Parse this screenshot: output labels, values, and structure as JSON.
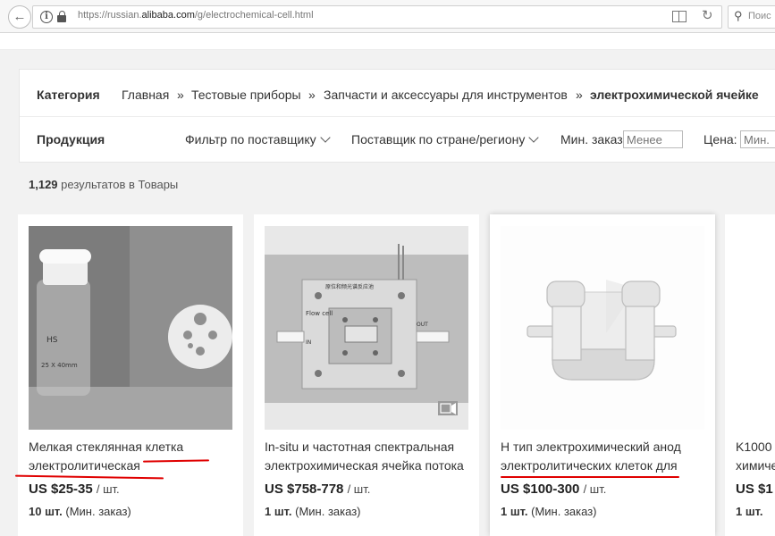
{
  "browser": {
    "url_prefix": "https://russian.",
    "url_domain": "alibaba.com",
    "url_path": "/g/electrochemical-cell.html",
    "search_placeholder": "Поис"
  },
  "breadcrumb": {
    "label": "Категория",
    "items": [
      "Главная",
      "Тестовые приборы",
      "Запчасти и аксессуары для инструментов",
      "электрохимической ячейке"
    ],
    "separator": "»"
  },
  "filters": {
    "label": "Продукция",
    "supplier_filter": "Фильтр по поставщику",
    "country_filter": "Поставщик по стране/региону",
    "min_order_label": "Мин. заказ",
    "min_order_placeholder": "Менее",
    "price_label": "Цена:",
    "price_placeholder": "Мин."
  },
  "results": {
    "count": "1,129",
    "text": "результатов в Товары"
  },
  "products": [
    {
      "title_line1": "Мелкая стеклянная клетка",
      "title_line2": "электролитическая",
      "price": "US $25-35",
      "unit": "/ шт.",
      "moq_qty": "10 шт.",
      "moq_label": "(Мин. заказ)"
    },
    {
      "title_line1": "In-situ и частотная спектральная",
      "title_line2": "электрохимическая ячейка потока",
      "price": "US $758-778",
      "unit": "/ шт.",
      "moq_qty": "1 шт.",
      "moq_label": "(Мин. заказ)",
      "image_text_top": "原位和频光谱反应池",
      "image_text_flow": "Flow cell",
      "image_text_in": "IN",
      "image_text_out": "OUT"
    },
    {
      "title_line1": "Н тип электрохимический анод",
      "title_line2": "электролитических клеток для",
      "price": "US $100-300",
      "unit": "/ шт.",
      "moq_qty": "1 шт.",
      "moq_label": "(Мин. заказ)"
    },
    {
      "title_line1": "K1000",
      "title_line2": "химиче",
      "price": "US $1",
      "moq_qty": "1 шт."
    }
  ],
  "image_labels": {
    "jar_brand": "HS",
    "jar_size": "25 X 40mm"
  },
  "colors": {
    "annotation_red": "#e00000",
    "page_bg": "#f2f2f2"
  }
}
